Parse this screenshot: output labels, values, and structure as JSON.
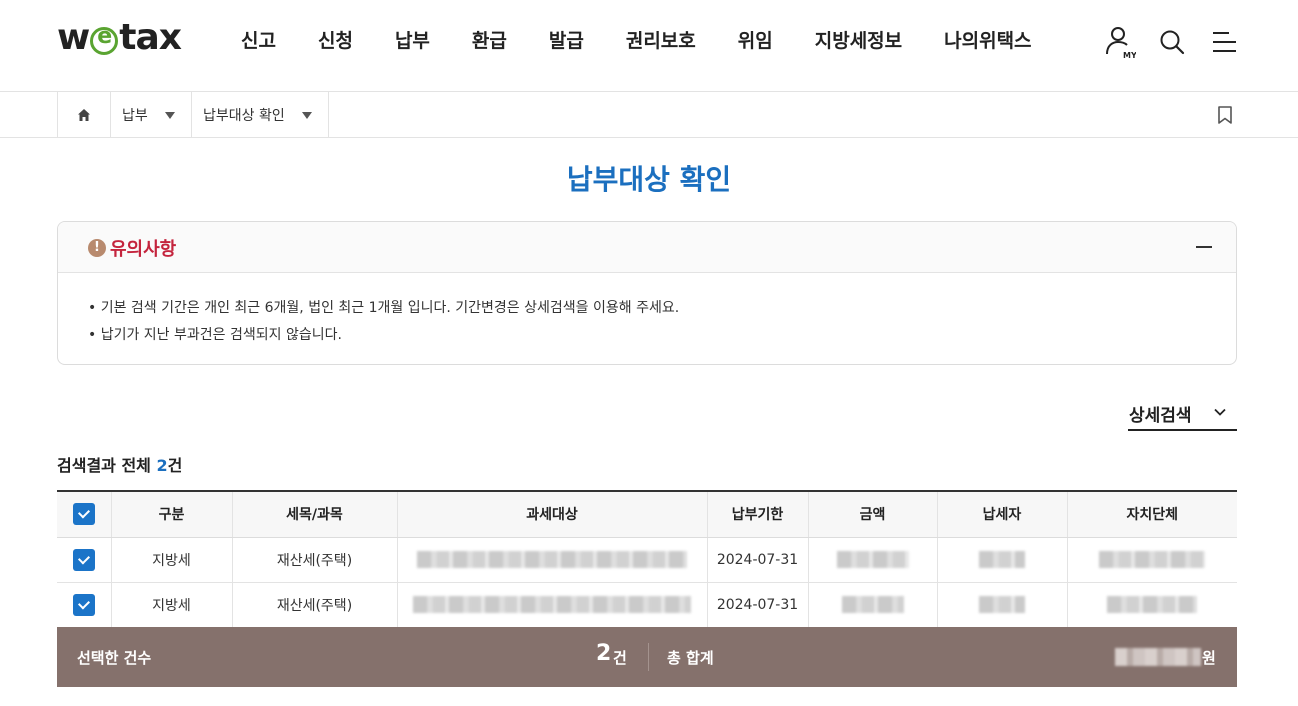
{
  "brand": {
    "logo_prefix": "w",
    "logo_suffix": "tax",
    "accent": "#5aa431"
  },
  "gnb": [
    "신고",
    "신청",
    "납부",
    "환급",
    "발급",
    "권리보호",
    "위임",
    "지방세정보",
    "나의위택스"
  ],
  "util_icons": [
    "my-page-icon",
    "search-icon",
    "menu-icon"
  ],
  "util_my_label": "MY",
  "breadcrumb": {
    "level1": "납부",
    "level2": "납부대상 확인"
  },
  "page_title": "납부대상 확인",
  "notice": {
    "title": "유의사항",
    "icon_glyph": "!",
    "lines": [
      "• 기본 검색 기간은 개인 최근 6개월, 법인 최근 1개월 입니다. 기간변경은 상세검색을 이용해 주세요.",
      "• 납기가 지난 부과건은 검색되지 않습니다."
    ]
  },
  "detail_search": {
    "label": "상세검색"
  },
  "result": {
    "prefix": "검색결과 전체 ",
    "count": "2",
    "suffix": "건"
  },
  "table": {
    "headers": [
      "구분",
      "세목/과목",
      "과세대상",
      "납부기한",
      "금액",
      "납세자",
      "자치단체"
    ],
    "rows": [
      {
        "checked": true,
        "category": "지방세",
        "tax_item": "재산세(주택)",
        "due_date": "2024-07-31"
      },
      {
        "checked": true,
        "category": "지방세",
        "tax_item": "재산세(주택)",
        "due_date": "2024-07-31"
      }
    ]
  },
  "summary": {
    "selected_label": "선택한 건수",
    "selected_count": "2",
    "selected_unit": "건",
    "total_label": "총 합계",
    "currency": "원"
  },
  "colors": {
    "primary": "#1b6fbf",
    "notice_red": "#c4243d",
    "summary_bg": "#85716c"
  }
}
